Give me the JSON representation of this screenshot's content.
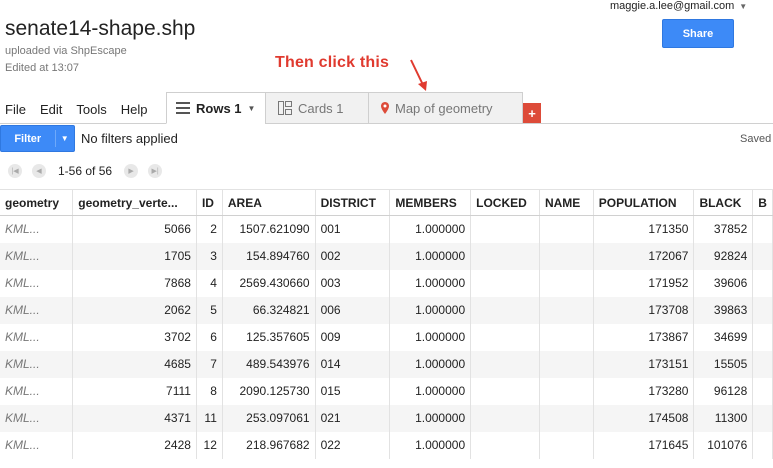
{
  "header": {
    "title": "senate14-shape.shp",
    "subtitle": "uploaded via ShpEscape",
    "edited": "Edited at 13:07",
    "user_email": "maggie.a.lee@gmail.com",
    "share_label": "Share"
  },
  "annotation": {
    "text": "Then click this",
    "color": "#e03a2f"
  },
  "menu": [
    "File",
    "Edit",
    "Tools",
    "Help"
  ],
  "tabs": [
    {
      "label": "Rows 1",
      "icon": "rows-icon",
      "active": true
    },
    {
      "label": "Cards 1",
      "icon": "cards-icon",
      "active": false
    },
    {
      "label": "Map of geometry",
      "icon": "map-pin-icon",
      "active": false
    }
  ],
  "add_tab_label": "+",
  "filter": {
    "button_label": "Filter",
    "status": "No filters applied",
    "saved": "Saved"
  },
  "pager": {
    "range": "1-56 of 56"
  },
  "colors": {
    "accent_blue": "#3d8af7",
    "add_tab_red": "#dd4b39"
  },
  "table": {
    "columns": [
      "geometry",
      "geometry_verte...",
      "ID",
      "AREA",
      "DISTRICT",
      "MEMBERS",
      "LOCKED",
      "NAME",
      "POPULATION",
      "BLACK",
      "B"
    ],
    "rows": [
      [
        "KML...",
        "5066",
        "2",
        "1507.621090",
        "001",
        "1.000000",
        "",
        "",
        "171350",
        "37852",
        ""
      ],
      [
        "KML...",
        "1705",
        "3",
        "154.894760",
        "002",
        "1.000000",
        "",
        "",
        "172067",
        "92824",
        ""
      ],
      [
        "KML...",
        "7868",
        "4",
        "2569.430660",
        "003",
        "1.000000",
        "",
        "",
        "171952",
        "39606",
        ""
      ],
      [
        "KML...",
        "2062",
        "5",
        "66.324821",
        "006",
        "1.000000",
        "",
        "",
        "173708",
        "39863",
        ""
      ],
      [
        "KML...",
        "3702",
        "6",
        "125.357605",
        "009",
        "1.000000",
        "",
        "",
        "173867",
        "34699",
        ""
      ],
      [
        "KML...",
        "4685",
        "7",
        "489.543976",
        "014",
        "1.000000",
        "",
        "",
        "173151",
        "15505",
        ""
      ],
      [
        "KML...",
        "7111",
        "8",
        "2090.125730",
        "015",
        "1.000000",
        "",
        "",
        "173280",
        "96128",
        ""
      ],
      [
        "KML...",
        "4371",
        "11",
        "253.097061",
        "021",
        "1.000000",
        "",
        "",
        "174508",
        "11300",
        ""
      ],
      [
        "KML...",
        "2428",
        "12",
        "218.967682",
        "022",
        "1.000000",
        "",
        "",
        "171645",
        "101076",
        ""
      ]
    ]
  }
}
